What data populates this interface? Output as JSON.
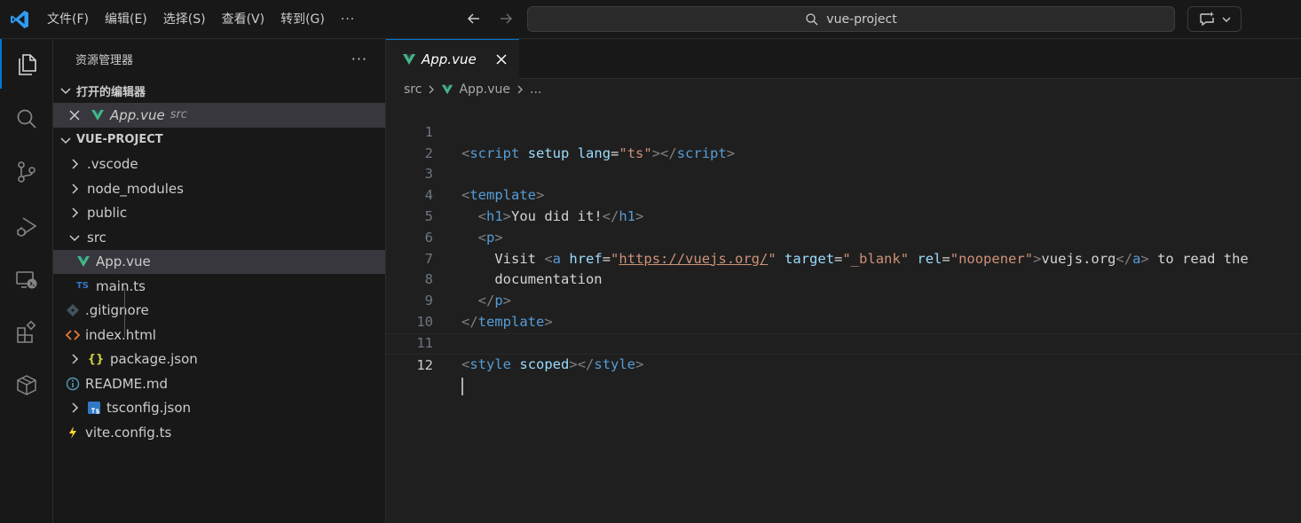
{
  "colors": {
    "accent": "#0078d4",
    "vue": "#41b883",
    "ts": "#3178c6"
  },
  "menu": [
    "文件(F)",
    "编辑(E)",
    "选择(S)",
    "查看(V)",
    "转到(G)",
    "···"
  ],
  "search": {
    "text": "vue-project"
  },
  "sidebar": {
    "title": "资源管理器",
    "more": "···",
    "open_editors_label": "打开的编辑器",
    "open_editors": [
      {
        "name": "App.vue",
        "desc": "src"
      }
    ],
    "project_label": "VUE-PROJECT",
    "items": [
      {
        "label": ".vscode",
        "icon": "chevron-right-icon"
      },
      {
        "label": "node_modules",
        "icon": "chevron-right-icon"
      },
      {
        "label": "public",
        "icon": "chevron-right-icon"
      },
      {
        "label": "src",
        "icon": "chevron-down-icon"
      },
      {
        "label": "App.vue",
        "icon": "vue-icon"
      },
      {
        "label": "main.ts",
        "icon": "ts-icon"
      },
      {
        "label": ".gitignore",
        "icon": "git-icon"
      },
      {
        "label": "index.html",
        "icon": "html-icon"
      },
      {
        "label": "package.json",
        "icon": "json-icon"
      },
      {
        "label": "README.md",
        "icon": "info-icon"
      },
      {
        "label": "tsconfig.json",
        "icon": "tsconfig-icon"
      },
      {
        "label": "vite.config.ts",
        "icon": "vite-icon"
      }
    ]
  },
  "editor": {
    "tab_label": "App.vue",
    "breadcrumb": [
      "src",
      "App.vue",
      "..."
    ],
    "line_numbers": [
      "1",
      "2",
      "3",
      "4",
      "5",
      "6",
      "7",
      "8",
      "9",
      "10",
      "11",
      "12"
    ],
    "code": {
      "l1": [
        "<",
        "script",
        " ",
        "setup",
        " ",
        "lang",
        "=",
        "\"ts\"",
        "></",
        "script",
        ">"
      ],
      "l3": [
        "<",
        "template",
        ">"
      ],
      "l4": [
        "  <",
        "h1",
        ">",
        "You did it!",
        "</",
        "h1",
        ">"
      ],
      "l5": [
        "  <",
        "p",
        ">"
      ],
      "l6": [
        "    Visit ",
        "<",
        "a",
        " ",
        "href",
        "=",
        "\"",
        "https://vuejs.org/",
        "\"",
        " ",
        "target",
        "=",
        "\"_blank\"",
        " ",
        "rel",
        "=",
        "\"noopener\"",
        ">",
        "vuejs.org",
        "</",
        "a",
        ">",
        " to read the"
      ],
      "l7": [
        "    documentation"
      ],
      "l8": [
        "  </",
        "p",
        ">"
      ],
      "l9": [
        "</",
        "template",
        ">"
      ],
      "l11": [
        "<",
        "style",
        " ",
        "scoped",
        "></",
        "style",
        ">"
      ]
    }
  }
}
